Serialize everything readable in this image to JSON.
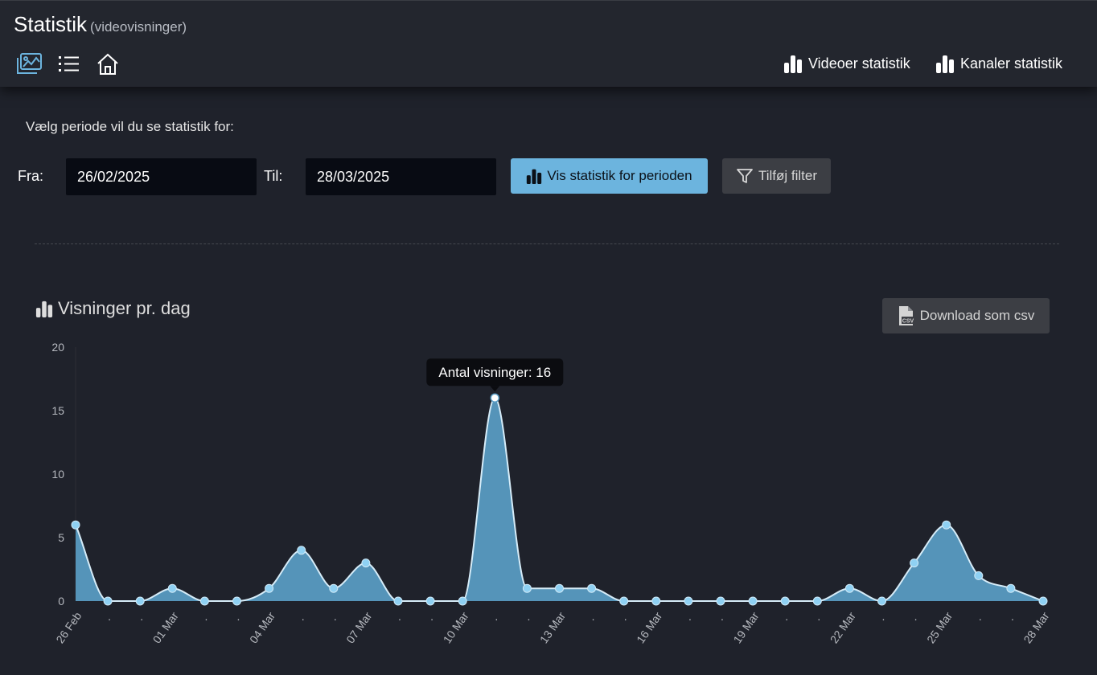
{
  "header": {
    "title": "Statistik",
    "subtitle": "(videovisninger)",
    "icons": [
      "chart-image-icon",
      "list-icon",
      "home-icon"
    ],
    "links": {
      "videos": "Videoer statistik",
      "channels": "Kanaler statistik"
    }
  },
  "period": {
    "prompt": "Vælg periode vil du se statistik for:",
    "from_label": "Fra:",
    "from_value": "26/02/2025",
    "to_label": "Til:",
    "to_value": "28/03/2025",
    "show_button": "Vis statistik for perioden",
    "filter_button": "Tilføj filter"
  },
  "chart_section": {
    "title": "Visninger pr. dag",
    "csv_button": "Download som csv",
    "tooltip": "Antal visninger: 16"
  },
  "colors": {
    "accent": "#6cb4de",
    "area": "#5a9ec6",
    "point": "#8fd1f3"
  },
  "chart_data": {
    "type": "area",
    "title": "",
    "xlabel": "",
    "ylabel": "",
    "ylim": [
      0,
      20
    ],
    "yticks": [
      0,
      5,
      10,
      15,
      20
    ],
    "grid": false,
    "x": [
      "26 Feb",
      "27 Feb",
      "28 Feb",
      "01 Mar",
      "02 Mar",
      "03 Mar",
      "04 Mar",
      "05 Mar",
      "06 Mar",
      "07 Mar",
      "08 Mar",
      "09 Mar",
      "10 Mar",
      "11 Mar",
      "12 Mar",
      "13 Mar",
      "14 Mar",
      "15 Mar",
      "16 Mar",
      "17 Mar",
      "18 Mar",
      "19 Mar",
      "20 Mar",
      "21 Mar",
      "22 Mar",
      "23 Mar",
      "24 Mar",
      "25 Mar",
      "26 Mar",
      "27 Mar",
      "28 Mar"
    ],
    "x_tick_labels": [
      "26 Feb",
      ".",
      ".",
      "01 Mar",
      ".",
      ".",
      "04 Mar",
      ".",
      ".",
      "07 Mar",
      ".",
      ".",
      "10 Mar",
      ".",
      ".",
      "13 Mar",
      ".",
      ".",
      "16 Mar",
      ".",
      ".",
      "19 Mar",
      ".",
      ".",
      "22 Mar",
      ".",
      ".",
      "25 Mar",
      ".",
      ".",
      "28 Mar"
    ],
    "series": [
      {
        "values": [
          6,
          0,
          0,
          1,
          0,
          0,
          1,
          4,
          1,
          3,
          0,
          0,
          0,
          16,
          1,
          1,
          1,
          0,
          0,
          0,
          0,
          0,
          0,
          0,
          1,
          0,
          3,
          6,
          2,
          1,
          0
        ]
      }
    ],
    "highlighted_index": 13
  }
}
